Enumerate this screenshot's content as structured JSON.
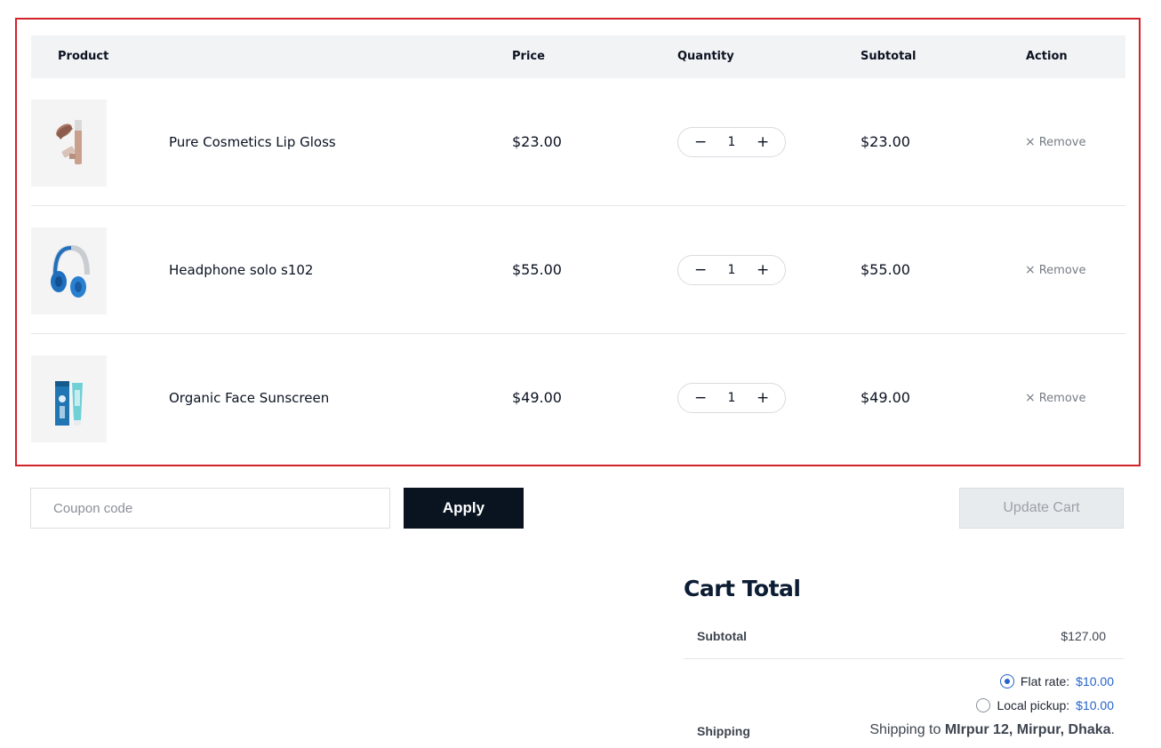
{
  "table": {
    "headers": {
      "product": "Product",
      "price": "Price",
      "quantity": "Quantity",
      "subtotal": "Subtotal",
      "action": "Action"
    },
    "rows": [
      {
        "name": "Pure Cosmetics Lip Gloss",
        "price": "$23.00",
        "quantity": "1",
        "subtotal": "$23.00",
        "remove": "Remove",
        "minus": "−",
        "plus": "+",
        "remove_icon": "×",
        "image": "lip-gloss-image"
      },
      {
        "name": "Headphone solo s102",
        "price": "$55.00",
        "quantity": "1",
        "subtotal": "$55.00",
        "remove": "Remove",
        "minus": "−",
        "plus": "+",
        "remove_icon": "×",
        "image": "headphone-image"
      },
      {
        "name": "Organic Face Sunscreen",
        "price": "$49.00",
        "quantity": "1",
        "subtotal": "$49.00",
        "remove": "Remove",
        "minus": "−",
        "plus": "+",
        "remove_icon": "×",
        "image": "sunscreen-image"
      }
    ]
  },
  "coupon": {
    "placeholder": "Coupon code",
    "apply_label": "Apply"
  },
  "update_cart_label": "Update Cart",
  "cart_total": {
    "title": "Cart Total",
    "subtotal_label": "Subtotal",
    "subtotal_value": "$127.00",
    "shipping_label": "Shipping",
    "options": [
      {
        "label": "Flat rate:",
        "price": "$10.00",
        "selected": true
      },
      {
        "label": "Local pickup:",
        "price": "$10.00",
        "selected": false
      }
    ],
    "shipping_to_prefix": "Shipping to",
    "shipping_to_address": "MIrpur 12, Mirpur, Dhaka",
    "shipping_to_suffix": "."
  },
  "colors": {
    "highlight_border": "#d2232a",
    "header_bg": "#f2f3f5",
    "apply_bg": "#0a1420",
    "link_blue": "#2563c9"
  }
}
